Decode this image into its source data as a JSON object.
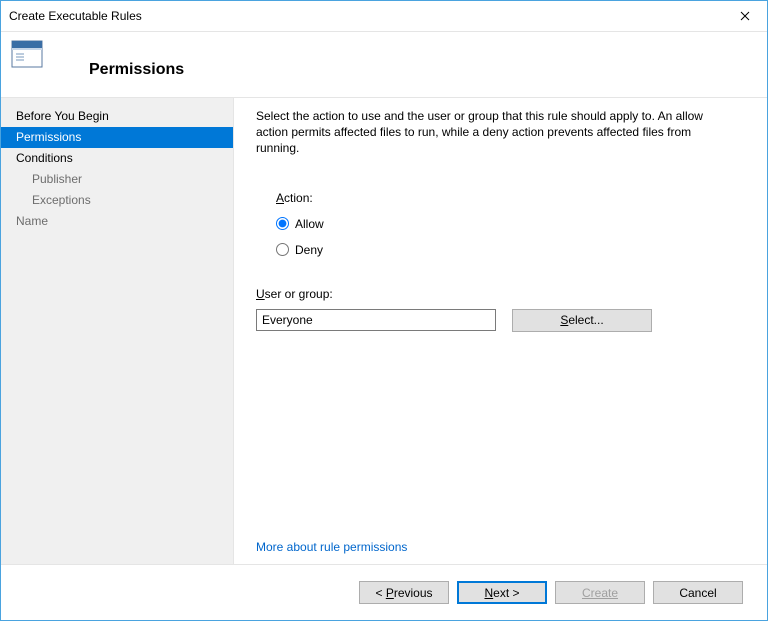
{
  "window": {
    "title": "Create Executable Rules"
  },
  "header": {
    "title": "Permissions"
  },
  "sidebar": {
    "items": [
      {
        "label": "Before You Begin",
        "selected": false,
        "child": false,
        "muted": false
      },
      {
        "label": "Permissions",
        "selected": true,
        "child": false,
        "muted": false
      },
      {
        "label": "Conditions",
        "selected": false,
        "child": false,
        "muted": false
      },
      {
        "label": "Publisher",
        "selected": false,
        "child": true,
        "muted": true
      },
      {
        "label": "Exceptions",
        "selected": false,
        "child": true,
        "muted": true
      },
      {
        "label": "Name",
        "selected": false,
        "child": false,
        "muted": true
      }
    ]
  },
  "content": {
    "description": "Select the action to use and the user or group that this rule should apply to. An allow action permits affected files to run, while a deny action prevents affected files from running.",
    "action_label_prefix": "A",
    "action_label_rest": "ction:",
    "radio_allow": "Allow",
    "radio_deny": "Deny",
    "action_selected": "allow",
    "usergroup_label_prefix": "U",
    "usergroup_label_rest": "ser or group:",
    "usergroup_value": "Everyone",
    "select_button_prefix": "",
    "select_button_underline": "S",
    "select_button_rest": "elect...",
    "more_link": "More about rule permissions"
  },
  "footer": {
    "previous_prefix": "< ",
    "previous_underline": "P",
    "previous_rest": "revious",
    "next_underline": "N",
    "next_rest": "ext >",
    "create": "Create",
    "cancel": "Cancel"
  }
}
